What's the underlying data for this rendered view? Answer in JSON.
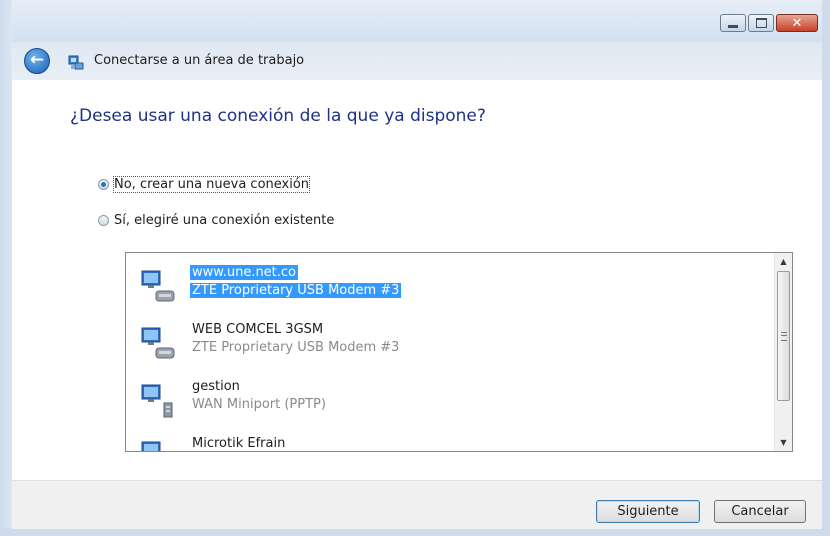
{
  "window": {
    "title": "Conectarse a un área de trabajo",
    "controls": {
      "minimize": "minimize-icon",
      "maximize": "maximize-icon",
      "close": "close-icon"
    }
  },
  "page": {
    "heading": "¿Desea usar una conexión de la que ya dispone?",
    "options": [
      {
        "label": "No, crear una nueva conexión",
        "selected": true
      },
      {
        "label": "Sí, elegiré una conexión existente",
        "selected": false
      }
    ]
  },
  "connections": [
    {
      "name": "www.une.net.co",
      "device": "ZTE Proprietary USB Modem #3",
      "selected": true
    },
    {
      "name": "WEB COMCEL 3GSM",
      "device": "ZTE Proprietary USB Modem #3",
      "selected": false
    },
    {
      "name": "gestion",
      "device": "WAN Miniport (PPTP)",
      "selected": false
    },
    {
      "name": "Microtik Efrain",
      "device": "",
      "selected": false
    }
  ],
  "footer": {
    "next": "Siguiente",
    "cancel": "Cancelar"
  },
  "colors": {
    "selection": "#3399ff",
    "heading": "#1e3287"
  }
}
